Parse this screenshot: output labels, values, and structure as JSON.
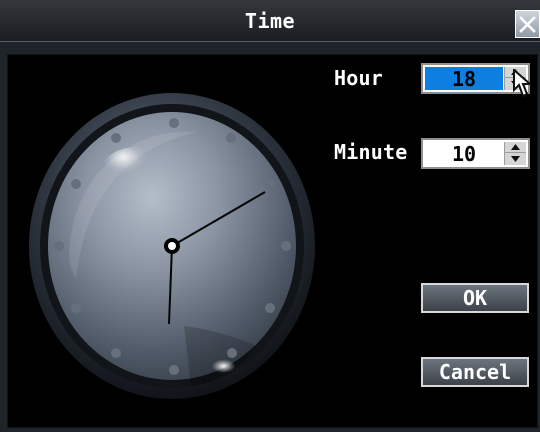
{
  "window": {
    "title": "Time"
  },
  "form": {
    "hour_label": "Hour",
    "hour_value": "18",
    "minute_label": "Minute",
    "minute_value": "10"
  },
  "buttons": {
    "ok_label": "OK",
    "cancel_label": "Cancel"
  },
  "icons": {
    "close": "close-icon",
    "spin_up": "arrow-up-icon",
    "spin_down": "arrow-down-icon",
    "pointer": "mouse-pointer-icon",
    "clock": "analog-clock-icon"
  },
  "colors": {
    "hour_field_bg": "#0d7fe0",
    "window_bg": "#1f242b",
    "content_bg": "#000000",
    "button_border": "#d8d8d8",
    "clock_face": "#8b94a3"
  }
}
